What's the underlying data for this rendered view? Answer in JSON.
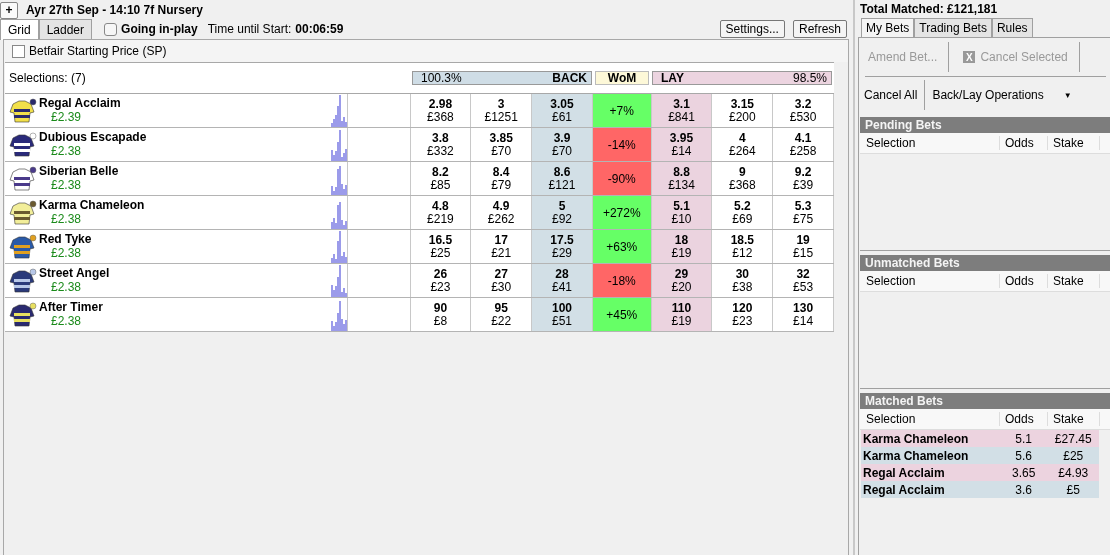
{
  "market": {
    "add_button": "+",
    "title": "Ayr 27th Sep - 14:10 7f Nursery"
  },
  "view_tabs": [
    {
      "label": "Grid",
      "selected": true
    },
    {
      "label": "Ladder",
      "selected": false
    }
  ],
  "going_in_play": {
    "label": "Going in-play",
    "checked": false
  },
  "countdown": {
    "label": "Time until Start:",
    "value": "00:06:59"
  },
  "buttons": [
    "Settings...",
    "Refresh"
  ],
  "starting_price": {
    "label": "Betfair Starting Price (SP)",
    "checked": false
  },
  "selections_label": "Selections: (7)",
  "book": {
    "back_percent": "100.3%",
    "back_label": "BACK",
    "wom_label": "WoM",
    "lay_label": "LAY",
    "lay_percent": "98.5%"
  },
  "runners": [
    {
      "name": "Regal Acclaim",
      "pl": "£2.39",
      "prices": [
        [
          "2.98",
          "£368"
        ],
        [
          "3",
          "£1251"
        ],
        [
          "3.05",
          "£61"
        ],
        [
          "3.1",
          "£841"
        ],
        [
          "3.15",
          "£200"
        ],
        [
          "3.2",
          "£530"
        ]
      ],
      "wom": "+7%",
      "color": "#66ff66"
    },
    {
      "name": "Dubious Escapade",
      "pl": "£2.38",
      "prices": [
        [
          "3.8",
          "£332"
        ],
        [
          "3.85",
          "£70"
        ],
        [
          "3.9",
          "£70"
        ],
        [
          "3.95",
          "£14"
        ],
        [
          "4",
          "£264"
        ],
        [
          "4.1",
          "£258"
        ]
      ],
      "wom": "-14%",
      "color": "#ff6666"
    },
    {
      "name": "Siberian Belle",
      "pl": "£2.38",
      "prices": [
        [
          "8.2",
          "£85"
        ],
        [
          "8.4",
          "£79"
        ],
        [
          "8.6",
          "£121"
        ],
        [
          "8.8",
          "£134"
        ],
        [
          "9",
          "£368"
        ],
        [
          "9.2",
          "£39"
        ]
      ],
      "wom": "-90%",
      "color": "#ff6666"
    },
    {
      "name": "Karma Chameleon",
      "pl": "£2.38",
      "prices": [
        [
          "4.8",
          "£219"
        ],
        [
          "4.9",
          "£262"
        ],
        [
          "5",
          "£92"
        ],
        [
          "5.1",
          "£10"
        ],
        [
          "5.2",
          "£69"
        ],
        [
          "5.3",
          "£75"
        ]
      ],
      "wom": "+272%",
      "color": "#66ff66"
    },
    {
      "name": "Red Tyke",
      "pl": "£2.38",
      "prices": [
        [
          "16.5",
          "£25"
        ],
        [
          "17",
          "£21"
        ],
        [
          "17.5",
          "£29"
        ],
        [
          "18",
          "£19"
        ],
        [
          "18.5",
          "£12"
        ],
        [
          "19",
          "£15"
        ]
      ],
      "wom": "+63%",
      "color": "#66ff66"
    },
    {
      "name": "Street Angel",
      "pl": "£2.38",
      "prices": [
        [
          "26",
          "£23"
        ],
        [
          "27",
          "£30"
        ],
        [
          "28",
          "£41"
        ],
        [
          "29",
          "£20"
        ],
        [
          "30",
          "£38"
        ],
        [
          "32",
          "£53"
        ]
      ],
      "wom": "-18%",
      "color": "#ff6666"
    },
    {
      "name": "After Timer",
      "pl": "£2.38",
      "prices": [
        [
          "90",
          "£8"
        ],
        [
          "95",
          "£22"
        ],
        [
          "100",
          "£51"
        ],
        [
          "110",
          "£19"
        ],
        [
          "120",
          "£23"
        ],
        [
          "130",
          "£14"
        ]
      ],
      "wom": "+45%",
      "color": "#66ff66"
    }
  ],
  "total_matched": "Total Matched: £121,181",
  "bet_tabs": [
    {
      "label": "My Bets",
      "selected": true
    },
    {
      "label": "Trading Bets",
      "selected": false
    },
    {
      "label": "Rules",
      "selected": false
    }
  ],
  "toolbar": {
    "amend": {
      "label": "Amend Bet...",
      "disabled": true
    },
    "cancel_icon": "X",
    "cancel_selected": {
      "label": "Cancel Selected",
      "disabled": true
    },
    "cancel_all": "Cancel All",
    "operations": "Back/Lay Operations",
    "operations_caret": "▼"
  },
  "sections": [
    {
      "title": "Pending Bets",
      "columns": [
        "Selection",
        "Odds",
        "Stake"
      ]
    },
    {
      "title": "Unmatched Bets",
      "columns": [
        "Selection",
        "Odds",
        "Stake"
      ]
    },
    {
      "title": "Matched Bets",
      "columns": [
        "Selection",
        "Odds",
        "Stake"
      ],
      "rows": [
        {
          "selection": "Karma Chameleon",
          "odds": "5.1",
          "stake": "£27.45",
          "kind": "lay"
        },
        {
          "selection": "Karma Chameleon",
          "odds": "5.6",
          "stake": "£25",
          "kind": "back"
        },
        {
          "selection": "Regal Acclaim",
          "odds": "3.65",
          "stake": "£4.93",
          "kind": "lay"
        },
        {
          "selection": "Regal Acclaim",
          "odds": "3.6",
          "stake": "£5",
          "kind": "back"
        }
      ]
    }
  ]
}
